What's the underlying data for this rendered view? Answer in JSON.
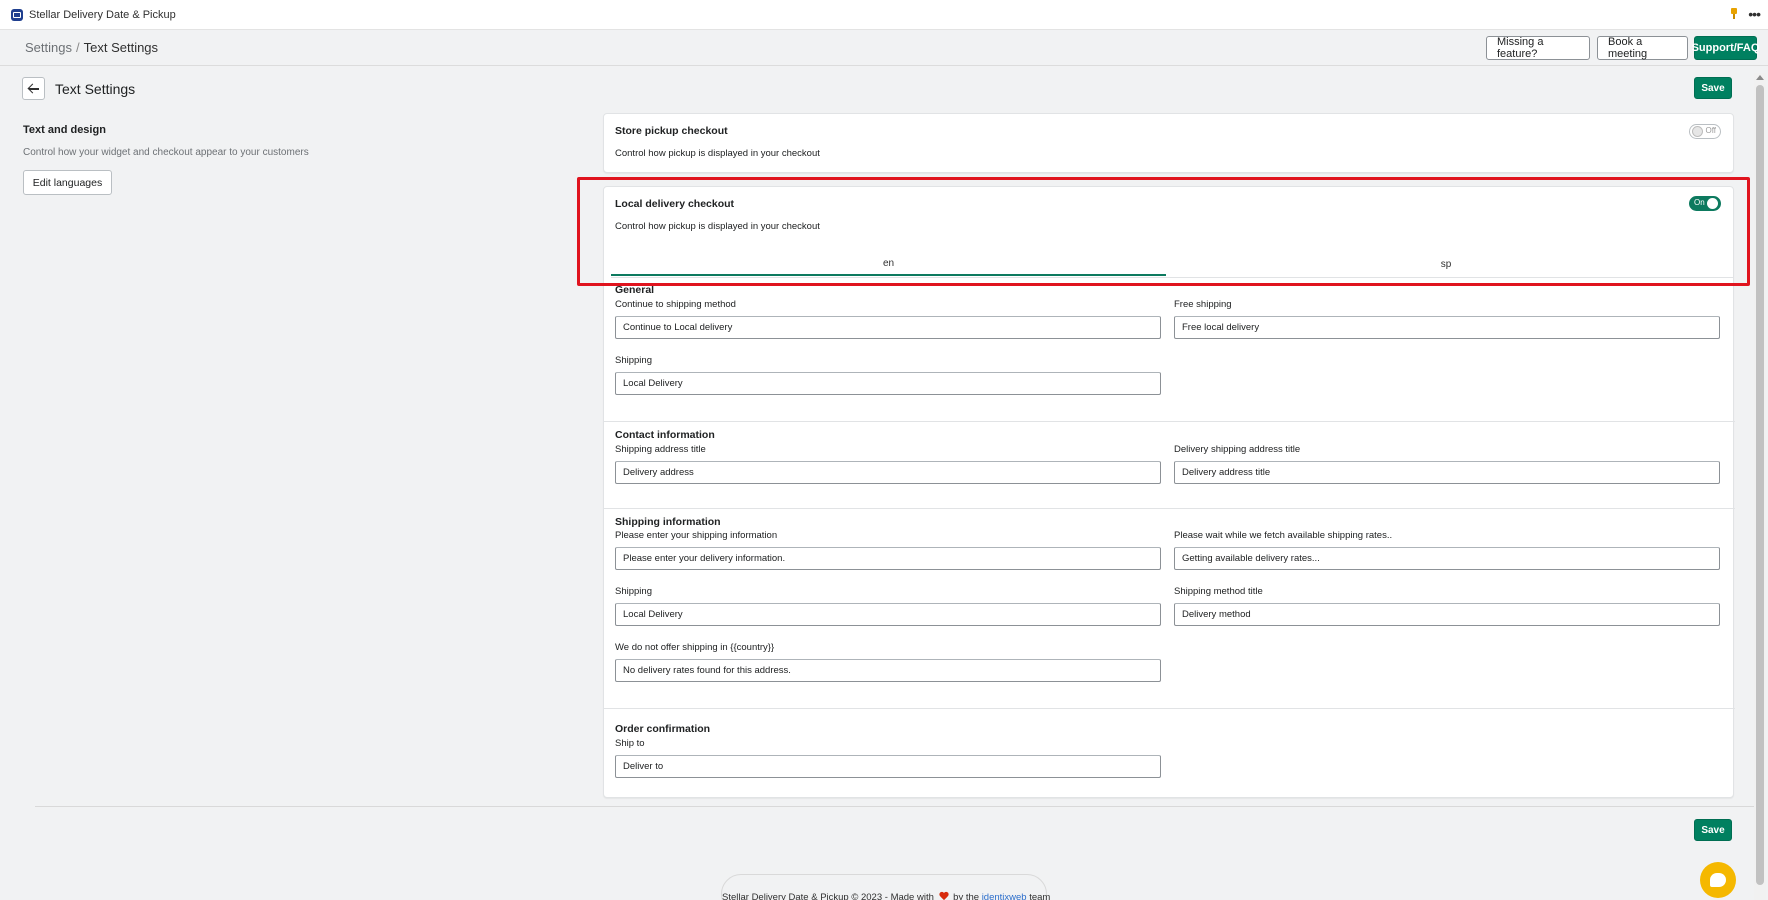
{
  "app": {
    "title": "Stellar Delivery Date & Pickup"
  },
  "breadcrumb": {
    "parent": "Settings",
    "separator": "/",
    "current": "Text Settings"
  },
  "header_buttons": {
    "missing_feature": "Missing a feature?",
    "book_meeting": "Book a meeting",
    "support": "Support/FAQ"
  },
  "page": {
    "title": "Text Settings",
    "save_label": "Save"
  },
  "sidebar": {
    "title": "Text and design",
    "description": "Control how your widget and checkout appear to your customers",
    "edit_languages": "Edit languages"
  },
  "store_pickup": {
    "title": "Store pickup checkout",
    "description": "Control how pickup is displayed in your checkout",
    "toggle_label": "Off"
  },
  "local_delivery": {
    "title": "Local delivery checkout",
    "description": "Control how pickup is displayed in your checkout",
    "toggle_label": "On",
    "tabs": [
      "en",
      "sp"
    ],
    "active_tab": "en"
  },
  "sections": {
    "general": {
      "title": "General",
      "continue_label": "Continue to shipping method",
      "continue_value": "Continue to Local delivery",
      "free_label": "Free shipping",
      "free_value": "Free local delivery",
      "shipping_label": "Shipping",
      "shipping_value": "Local Delivery"
    },
    "contact": {
      "title": "Contact information",
      "address_title_label": "Shipping address title",
      "address_title_value": "Delivery address",
      "delivery_address_label": "Delivery shipping address title",
      "delivery_address_value": "Delivery address title"
    },
    "shipping_info": {
      "title": "Shipping information",
      "enter_label": "Please enter your shipping information",
      "enter_value": "Please enter your delivery information.",
      "wait_label": "Please wait while we fetch available shipping rates..",
      "wait_value": "Getting available delivery rates...",
      "shipping_label": "Shipping",
      "shipping_value": "Local Delivery",
      "method_title_label": "Shipping method title",
      "method_title_value": "Delivery method",
      "no_offer_label": "We do not offer shipping in {{country}}",
      "no_offer_value": "No delivery rates found for this address."
    },
    "order": {
      "title": "Order confirmation",
      "ship_to_label": "Ship to",
      "ship_to_value": "Deliver to"
    }
  },
  "footer": {
    "text_before": "Stellar Delivery Date & Pickup © 2023 - Made with",
    "text_by": "by the",
    "link": "identixweb",
    "text_after": "team"
  },
  "colors": {
    "primary": "#008060",
    "highlight": "#e0141e",
    "chat": "#f5b800"
  }
}
